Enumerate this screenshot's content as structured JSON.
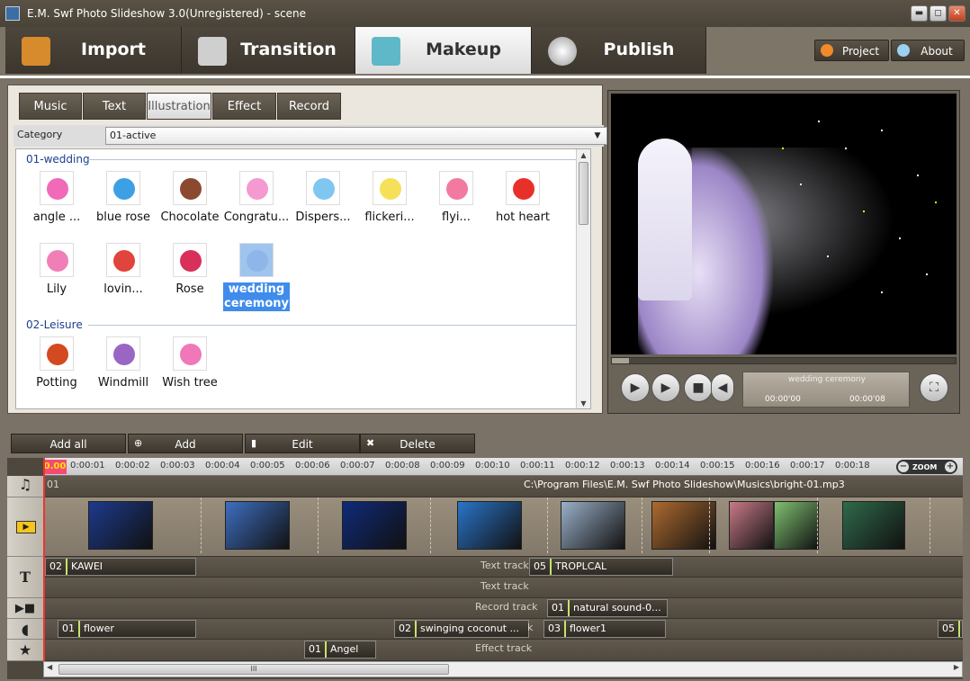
{
  "window": {
    "title": "E.M. Swf Photo Slideshow 3.0(Unregistered) - scene",
    "minimize": "▬",
    "maximize": "◻",
    "close": "✕"
  },
  "main_tabs": [
    {
      "label": "Import",
      "icon": "import-icon",
      "active": false
    },
    {
      "label": "Transition",
      "icon": "transition-icon",
      "active": false
    },
    {
      "label": "Makeup",
      "icon": "makeup-icon",
      "active": true
    },
    {
      "label": "Publish",
      "icon": "disc-icon",
      "active": false
    }
  ],
  "top_buttons": {
    "project": "Project",
    "about": "About"
  },
  "sub_tabs": [
    {
      "label": "Music",
      "active": false
    },
    {
      "label": "Text",
      "active": false
    },
    {
      "label": "Illustration",
      "active": true
    },
    {
      "label": "Effect",
      "active": false
    },
    {
      "label": "Record",
      "active": false
    }
  ],
  "category": {
    "label": "Category",
    "selected": "01-active"
  },
  "gallery": {
    "groups": [
      {
        "title": "01-wedding",
        "items": [
          {
            "label": "angle ...",
            "color": "#f06ab8"
          },
          {
            "label": "blue rose",
            "color": "#3ea0e4"
          },
          {
            "label": "Chocolate",
            "color": "#8b4a2f"
          },
          {
            "label": "Congratu...",
            "color": "#f49ad0"
          },
          {
            "label": "Dispers...",
            "color": "#7fc7f0"
          },
          {
            "label": "flickeri...",
            "color": "#f5e05a"
          },
          {
            "label": "flyi...",
            "color": "#f27aa0"
          },
          {
            "label": "hot heart",
            "color": "#e8302a"
          },
          {
            "label": "Lily",
            "color": "#f07fb8"
          },
          {
            "label": "lovin...",
            "color": "#e0443c"
          },
          {
            "label": "Rose",
            "color": "#d8305a"
          },
          {
            "label": "wedding ceremony",
            "color": "#8fb6e8",
            "selected": true
          }
        ]
      },
      {
        "title": "02-Leisure",
        "items": [
          {
            "label": "Potting",
            "color": "#d34a20"
          },
          {
            "label": "Windmill",
            "color": "#9a66c4"
          },
          {
            "label": "Wish tree",
            "color": "#f078b8"
          }
        ]
      }
    ]
  },
  "player": {
    "now_playing": "wedding ceremony",
    "current_time": "00:00'00",
    "total_time": "00:00'08",
    "progress": 0.05,
    "buttons": {
      "play_pause": "▶",
      "play": "▶",
      "stop": "■",
      "volume": "◀",
      "fullscreen": "⛶"
    }
  },
  "bottom_toolbar": {
    "add_all": "Add all",
    "add": "Add",
    "edit": "Edit",
    "delete": "Delete"
  },
  "timeline": {
    "zero": "0.00",
    "ticks": [
      "0:00:01",
      "0:00:02",
      "0:00:03",
      "0:00:04",
      "0:00:05",
      "0:00:06",
      "0:00:07",
      "0:00:08",
      "0:00:09",
      "0:00:10",
      "0:00:11",
      "0:00:12",
      "0:00:13",
      "0:00:14",
      "0:00:15",
      "0:00:16",
      "0:00:17",
      "0:00:18"
    ],
    "zoom": "ZOOM",
    "music_track": {
      "num": "01",
      "path": "C:\\Program Files\\E.M. Swf Photo Slideshow\\Musics\\bright-01.mp3"
    },
    "photo_colors": [
      "#1d3a8c",
      "#3e6ec0",
      "#0f2a7a",
      "#2a74c8",
      "#9ab0c8",
      "#ad6a30",
      "#c87a88",
      "#7fc070",
      "#2f6a4a"
    ],
    "text_track_1": {
      "clips": [
        {
          "num": "02",
          "name": "KAWEI"
        },
        {
          "num": "05",
          "name": "TROPLCAL"
        }
      ],
      "label": "Text track"
    },
    "text_track_2": {
      "label": "Text track"
    },
    "record_track": {
      "label": "Record track",
      "clips": [
        {
          "num": "01",
          "name": "natural sound-0..."
        }
      ]
    },
    "illustration_track": {
      "clips": [
        {
          "num": "01",
          "name": "flower"
        },
        {
          "num": "02",
          "name": "swinging coconut ..."
        },
        {
          "num": "03",
          "name": "flower1"
        },
        {
          "num": "05",
          "name": "E"
        }
      ],
      "tail": "k"
    },
    "effect_track": {
      "label": "Effect track",
      "clips": [
        {
          "num": "01",
          "name": "Angel"
        }
      ]
    },
    "scroll_grip": "III"
  }
}
